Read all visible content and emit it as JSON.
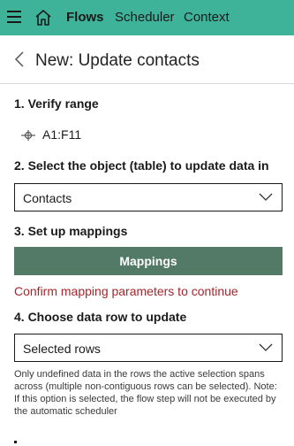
{
  "topbar": {
    "nav": [
      "Flows",
      "Scheduler",
      "Context"
    ],
    "active": "Flows",
    "color": "#3fb39a"
  },
  "header": {
    "title": "New: Update contacts"
  },
  "steps": {
    "verify_range": {
      "label": "1. Verify range",
      "value": "A1:F11"
    },
    "select_object": {
      "label": "2. Select the object (table) to update data in",
      "selected": "Contacts"
    },
    "mappings": {
      "label": "3. Set up mappings",
      "button": "Mappings",
      "error": "Confirm mapping parameters to continue"
    },
    "data_row": {
      "label": "4. Choose data row to update",
      "selected": "Selected rows",
      "help": "Only undefined data in the rows the active selection spans across (multiple non-contiguous rows can be selected). Note: If this option is selected, the flow step will not be executed by the automatic scheduler"
    }
  },
  "colors": {
    "button": "#527a67",
    "error": "#a4262c"
  }
}
